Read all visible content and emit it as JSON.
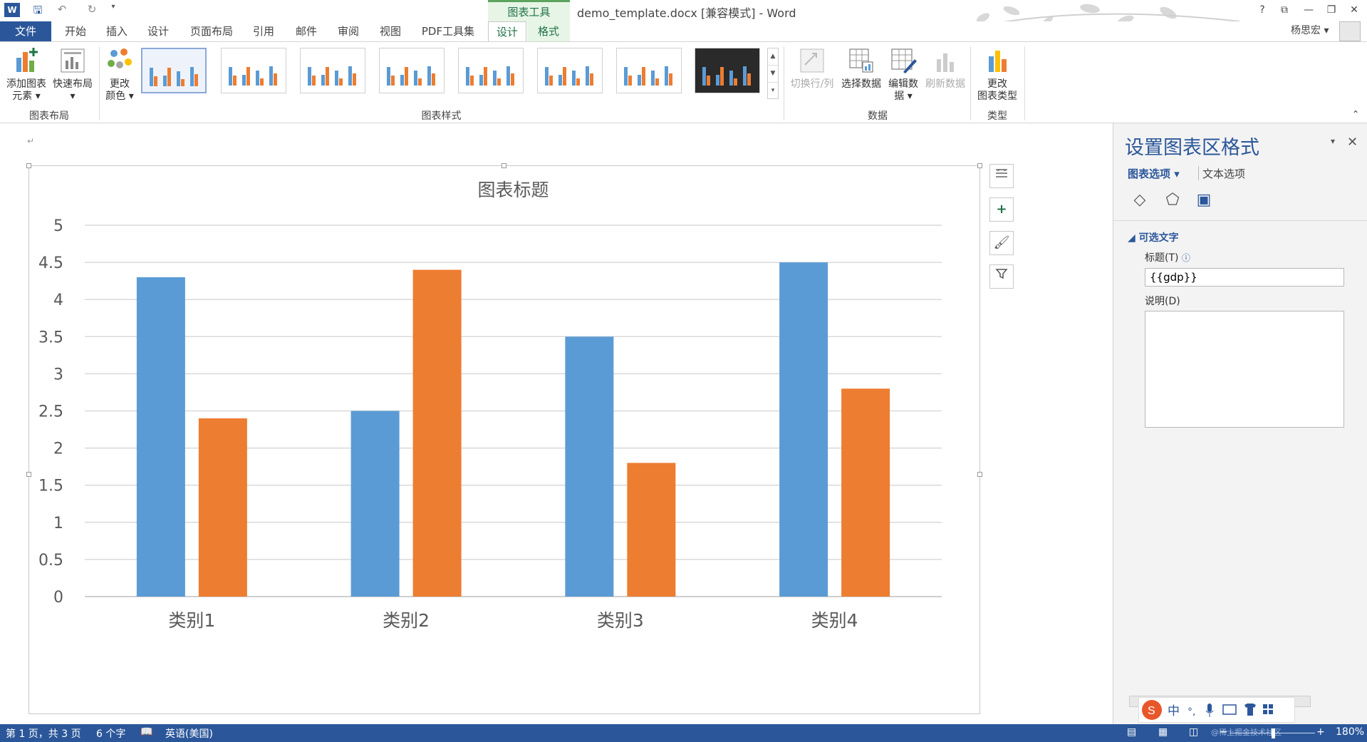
{
  "titlebar": {
    "context_label": "图表工具",
    "doc_title": "demo_template.docx [兼容模式] - Word",
    "quick_access": [
      "word-logo-icon",
      "save-icon",
      "undo-icon",
      "redo-icon",
      "customize-icon"
    ],
    "win_controls": [
      "?",
      "⧉",
      "—",
      "❐",
      "✕"
    ]
  },
  "tabs": {
    "file": "文件",
    "items": [
      "开始",
      "插入",
      "设计",
      "页面布局",
      "引用",
      "邮件",
      "审阅",
      "视图",
      "PDF工具集"
    ],
    "context": [
      "设计",
      "格式"
    ],
    "active": "设计"
  },
  "user": {
    "name": "杨思宏"
  },
  "ribbon": {
    "add_element": {
      "line1": "添加图表",
      "line2": "元素"
    },
    "quick_layout": {
      "line1": "快速布局"
    },
    "change_color": {
      "line1": "更改",
      "line2": "颜色"
    },
    "switch_row_col": "切换行/列",
    "select_data": "选择数据",
    "edit_data": {
      "line1": "编辑数",
      "line2": "据"
    },
    "refresh_data": "刷新数据",
    "change_type": {
      "line1": "更改",
      "line2": "图表类型"
    },
    "groups": {
      "layout": "图表布局",
      "styles": "图表样式",
      "data": "数据",
      "type": "类型"
    }
  },
  "chart_data": {
    "type": "bar",
    "title": "图表标题",
    "categories": [
      "类别1",
      "类别2",
      "类别3",
      "类别4"
    ],
    "series": [
      {
        "values": [
          4.3,
          2.5,
          3.5,
          4.5
        ],
        "color": "#5b9bd5"
      },
      {
        "values": [
          2.4,
          4.4,
          1.8,
          2.8
        ],
        "color": "#ed7d31"
      }
    ],
    "ylim": [
      0,
      5
    ],
    "yticks": [
      "0",
      "0.5",
      "1",
      "1.5",
      "2",
      "2.5",
      "3",
      "3.5",
      "4",
      "4.5",
      "5"
    ],
    "grid": true
  },
  "pane": {
    "title": "设置图表区格式",
    "tab_chart": "图表选项",
    "tab_text": "文本选项",
    "section": "可选文字",
    "title_label": "标题(T)",
    "title_value": "{{gdp}}",
    "desc_label": "说明(D)"
  },
  "statusbar": {
    "page": "第 1 页，共 3 页",
    "words": "6 个字",
    "lang": "英语(美国)",
    "zoom": "180%",
    "watermark": "@稀土掘金技术社区"
  },
  "colors": {
    "word_blue": "#2b579a",
    "context_green": "#217346",
    "bar_blue": "#5b9bd5",
    "bar_orange": "#ed7d31"
  }
}
